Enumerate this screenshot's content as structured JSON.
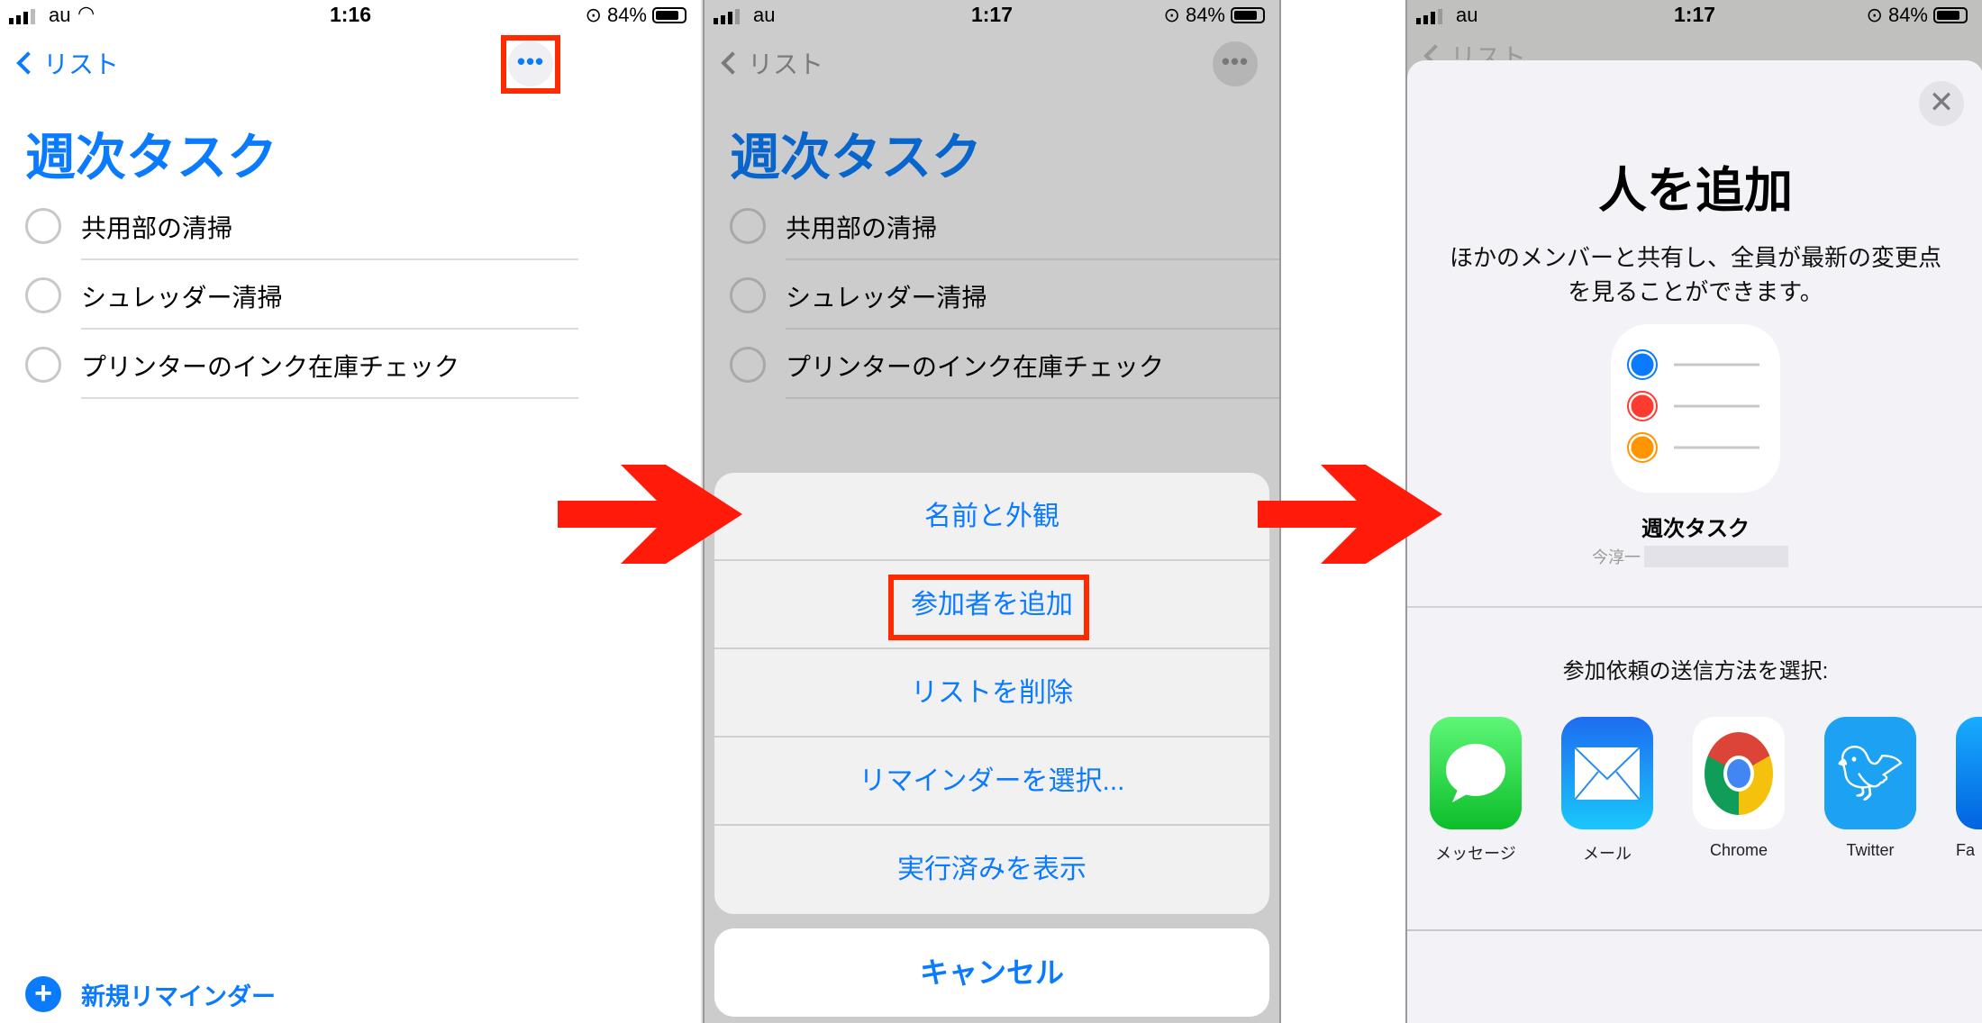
{
  "panel1": {
    "status": {
      "carrier": "au",
      "time": "1:16",
      "battery": "84%",
      "battery_level": 0.84
    },
    "nav": {
      "back_label": "リスト",
      "more_label": "•••"
    },
    "list_title": "週次タスク",
    "items": [
      {
        "label": "共用部の清掃"
      },
      {
        "label": "シュレッダー清掃"
      },
      {
        "label": "プリンターのインク在庫チェック"
      }
    ],
    "new_reminder": "新規リマインダー"
  },
  "panel2": {
    "status": {
      "carrier": "au",
      "time": "1:17",
      "battery": "84%"
    },
    "nav": {
      "back_label": "リスト",
      "more_label": "•••"
    },
    "list_title": "週次タスク",
    "items": [
      {
        "label": "共用部の清掃"
      },
      {
        "label": "シュレッダー清掃"
      },
      {
        "label": "プリンターのインク在庫チェック"
      }
    ],
    "action_sheet": {
      "options": [
        {
          "label": "名前と外観"
        },
        {
          "label": "参加者を追加"
        },
        {
          "label": "リストを削除"
        },
        {
          "label": "リマインダーを選択..."
        },
        {
          "label": "実行済みを表示"
        }
      ],
      "cancel": "キャンセル"
    }
  },
  "panel3": {
    "status": {
      "carrier": "au",
      "time": "1:17",
      "battery": "84%"
    },
    "nav": {
      "back_label": "リスト"
    },
    "title": "人を追加",
    "description_line1": "ほかのメンバーと共有し、全員が最新の変更点",
    "description_line2": "を見ることができます。",
    "list_name": "週次タスク",
    "owner": "今淳一",
    "send_prompt": "参加依頼の送信方法を選択:",
    "apps": [
      {
        "label": "メッセージ",
        "icon": "messages-icon"
      },
      {
        "label": "メール",
        "icon": "mail-icon"
      },
      {
        "label": "Chrome",
        "icon": "chrome-icon"
      },
      {
        "label": "Twitter",
        "icon": "twitter-icon"
      },
      {
        "label": "Fa",
        "icon": "facebook-icon"
      }
    ]
  },
  "colors": {
    "accent": "#0a7aff",
    "highlight": "#ff2a00",
    "arrow": "#ff1a0a",
    "dim": "#cccccc"
  }
}
